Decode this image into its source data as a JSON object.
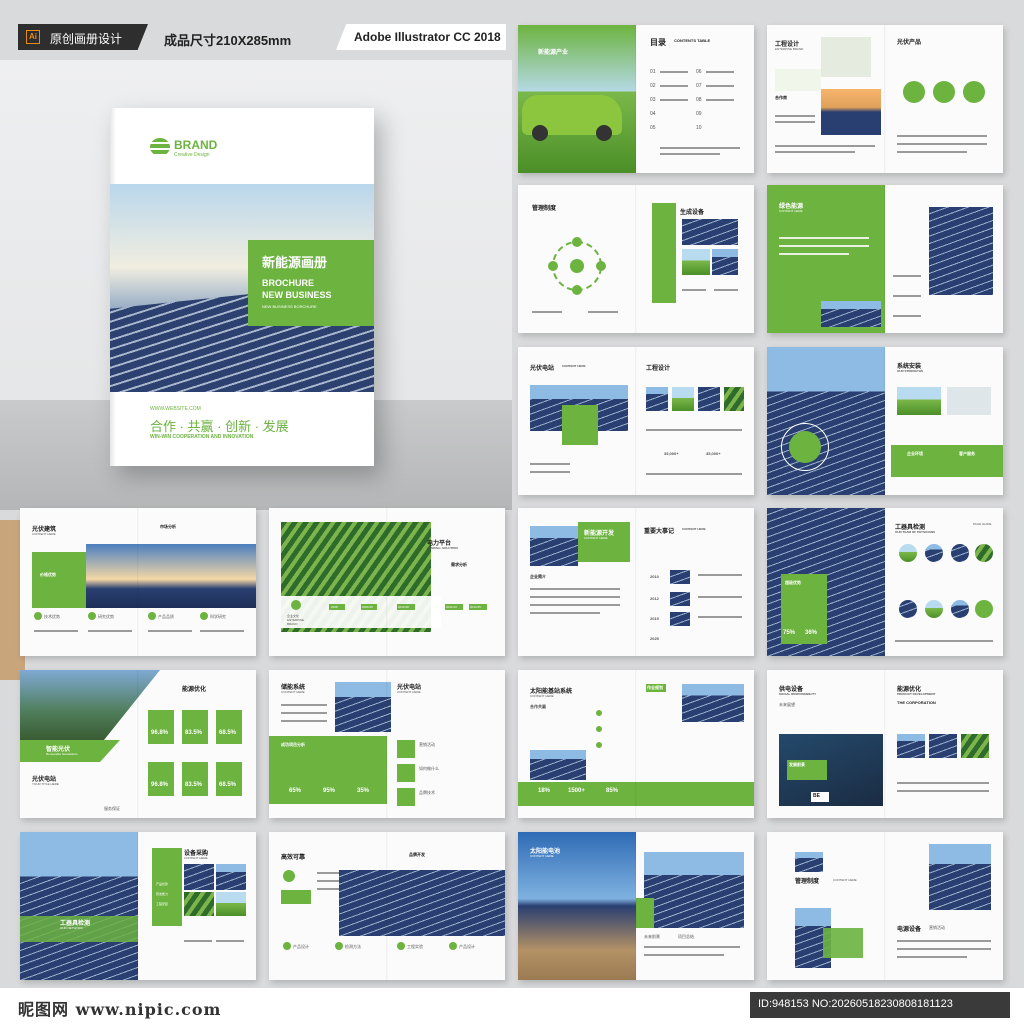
{
  "header": {
    "badge": "Ai",
    "tag1": "原创画册设计",
    "tag2": "成品尺寸210X285mm",
    "tag3": "Adobe Illustrator CC 2018"
  },
  "cover": {
    "brand": "BRAND",
    "brand_sub": "Creative Design",
    "title_cn": "新能源画册",
    "title_en_1": "BROCHURE",
    "title_en_2": "NEW BUSINESS",
    "title_en_sub": "NEW BUSINESS BORCHURE",
    "website": "WWW.WEBSITE.COM",
    "slogan": "合作 · 共赢 · 创新 · 发展",
    "slogan_en": "WIN-WIN COOPERATION AND INNOVATION"
  },
  "spreads": {
    "s1": {
      "label": "新能源产业",
      "toc": "目录",
      "toc_en": "CONTENTS TABLE",
      "nums": [
        "01",
        "02",
        "03",
        "04",
        "05",
        "06",
        "07",
        "08",
        "09",
        "10"
      ]
    },
    "s2": {
      "t1": "工程设计",
      "t1_en": "ENTERPISE BRAND",
      "t2": "光伏产品",
      "t3": "合作商"
    },
    "s3": {
      "t1": "管理制度",
      "t2": "生成设备"
    },
    "s4": {
      "t1": "绿色能源",
      "t1_en": "CONTENT HERE"
    },
    "s5": {
      "t1": "光伏电站",
      "t1_en": "CONTENT HERE",
      "t2": "工程设计",
      "n1": "35,000+",
      "n2": "35,000+"
    },
    "s6": {
      "t1": "系统安装",
      "t1_en": "OUR STRENGTHS",
      "a": "企业环境",
      "b": "客户服务"
    },
    "s7": {
      "t1": "光伏建筑",
      "t1_en": "CONTENT HERE",
      "t2": "市场分析",
      "g": "价格优势",
      "l1": "技术优势",
      "l2": "研究优势",
      "l3": "产品品质",
      "l4": "科学研究"
    },
    "s8": {
      "t1": "电力平台",
      "t1_en": "OVERALL SOLUTION",
      "t2": "需求分析",
      "e1": "企业文化",
      "e2": "ENTERPISE",
      "e3": "BRAND",
      "y": [
        "2008",
        "2009.05",
        "2010.08",
        "2012.03",
        "2013.05"
      ]
    },
    "s9": {
      "t1": "新能源开发",
      "t1_en": "CONTENT HERE",
      "t2": "重要大事记",
      "t2_en": "CONTENT HERE",
      "years": [
        "2010",
        "2012",
        "2019",
        "2025"
      ],
      "note": "企业简介"
    },
    "s10": {
      "t1": "工器具检测",
      "t1_en": "OUR TEAM OF PHYSICIANS",
      "pg": "PAGE GUIDE",
      "box": "超级优势",
      "p1": "75%",
      "p2": "36%"
    },
    "s11": {
      "t1": "能源优化",
      "tag": "智能光伏",
      "tag_en": "Renewable Newsletters",
      "t2": "光伏电站",
      "t2_en": "YOUR TITLE HERE",
      "v": [
        "96.8%",
        "83.5%",
        "68.5%",
        "96.8%",
        "83.5%",
        "68.5%"
      ],
      "trophy": "服务保证"
    },
    "s12": {
      "t1": "储能系统",
      "t1_en": "CONTENT HERE",
      "t2": "光伏电站",
      "t2_en": "CONTENT HERE",
      "box": "成功项目分析",
      "p": [
        "65%",
        "95%",
        "35%"
      ],
      "r": [
        "营销活动",
        "如何做什么",
        "品牌技术"
      ]
    },
    "s13": {
      "t1": "太阳能基站系统",
      "t1_en": "CONTENT HERE",
      "t2": "作业规划",
      "coop": "合作共赢",
      "n": [
        "18%",
        "1500+",
        "85%"
      ]
    },
    "s14": {
      "t1": "供电设备",
      "t1_en": "SOCIAL RESPONSIBILITY",
      "t2": "能源优化",
      "t2_en": "PRODUCT DEVELOPMENT",
      "t3": "THE CORPORATION",
      "box": "发展前景",
      "be": "BE",
      "n1": "未来展望"
    },
    "s15": {
      "t1": "设备采购",
      "t1_en": "CONTENT HERE",
      "box": "工器具检测",
      "box_en": "OUR NETWORK",
      "items": [
        "产品优势",
        "研发能力",
        "工程安装"
      ]
    },
    "s16": {
      "t1": "高效可靠",
      "t2": "品牌开发",
      "a": "产品设计",
      "b": "检测方法",
      "c": "工程实验",
      "d": "产品设计"
    },
    "s17": {
      "t1": "太阳能电池",
      "t1_en": "CONTENT HERE",
      "a": "未来前景",
      "b": "项目总结"
    },
    "s18": {
      "t1": "管理制度",
      "t1_en": "CONTENT HERE",
      "t2": "电源设备",
      "t3": "营销活动"
    }
  },
  "footer": {
    "left": "昵图网 www.nipic.com",
    "right": "ID:948153 NO:20260518230808181123"
  }
}
